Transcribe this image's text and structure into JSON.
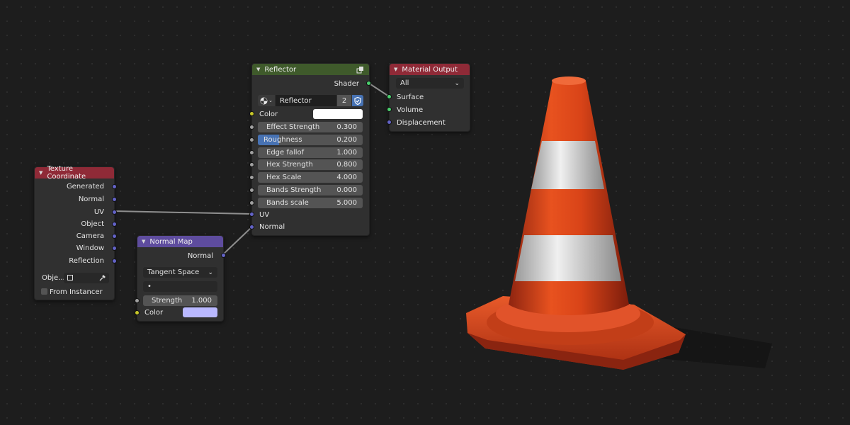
{
  "nodes": {
    "texture_coordinate": {
      "title": "Texture Coordinate",
      "outputs": [
        "Generated",
        "Normal",
        "UV",
        "Object",
        "Camera",
        "Window",
        "Reflection"
      ],
      "object_label": "Obje...",
      "from_instancer_label": "From Instancer",
      "from_instancer_checked": false
    },
    "normal_map": {
      "title": "Normal Map",
      "output": "Normal",
      "space_option": "Tangent Space",
      "uv_map_value": "•",
      "strength_label": "Strength",
      "strength_value": "1.000",
      "color_label": "Color",
      "color_value": "#b9b8ff"
    },
    "reflector": {
      "title": "Reflector",
      "output": "Shader",
      "datablock_name": "Reflector",
      "user_count": "2",
      "color_label": "Color",
      "color_value": "#ffffff",
      "fields": [
        {
          "label": "Effect Strength",
          "value": "0.300"
        },
        {
          "label": "Roughness",
          "value": "0.200",
          "fill": 0.2
        },
        {
          "label": "Edge fallof",
          "value": "1.000"
        },
        {
          "label": "Hex Strength",
          "value": "0.800"
        },
        {
          "label": "Hex Scale",
          "value": "4.000"
        },
        {
          "label": "Bands Strength",
          "value": "0.000"
        },
        {
          "label": "Bands scale",
          "value": "5.000"
        }
      ],
      "inputs": [
        "UV",
        "Normal"
      ]
    },
    "material_output": {
      "title": "Material Output",
      "target": "All",
      "inputs": [
        "Surface",
        "Volume",
        "Displacement"
      ]
    }
  },
  "colors": {
    "header_output": "#8f2a37",
    "header_shader": "#3f5a2b",
    "header_vector": "#5e4c9e",
    "socket_vector": "#6363c7",
    "socket_shader": "#4bd16e",
    "socket_color": "#c7c729",
    "socket_float": "#a1a1a1",
    "slider_fill": "#4772b3",
    "cone_orange": "#e24a1c",
    "cone_stripe": "#e6e6e6"
  },
  "preview": {
    "subject": "traffic-cone"
  }
}
